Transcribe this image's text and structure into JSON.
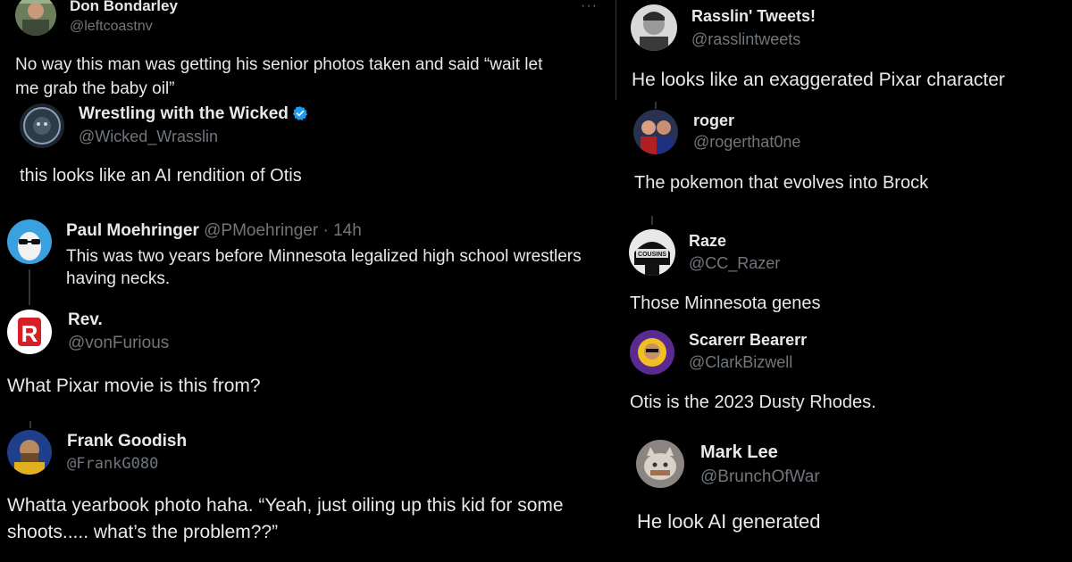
{
  "left": {
    "t1": {
      "name": "Don Bondarley",
      "handle": "@leftcoastnv",
      "text_l1": "No way this man was getting his senior photos taken and said “wait let",
      "text_l2": "me grab the baby oil”",
      "more": "···"
    },
    "t2": {
      "name": "Wrestling with the Wicked",
      "handle": "@Wicked_Wrasslin",
      "text": "this looks like an AI rendition of Otis"
    },
    "t3": {
      "name": "Paul Moehringer",
      "handle": "@PMoehringer",
      "time": "· 14h",
      "text_l1": "This was two years before Minnesota legalized high school wrestlers",
      "text_l2": "having necks."
    },
    "t4": {
      "name": "Rev.",
      "handle": "@vonFurious",
      "text": "What Pixar movie is this from?"
    },
    "t5": {
      "name": "Frank Goodish",
      "handle": "@FrankG080",
      "text_l1": "Whatta yearbook photo haha. “Yeah, just oiling up this kid for some",
      "text_l2": "shoots..... what’s the problem??”"
    }
  },
  "right": {
    "t1": {
      "name": "Rasslin' Tweets!",
      "handle": "@rasslintweets",
      "text": "He looks like an exaggerated Pixar character"
    },
    "t2": {
      "name": "roger",
      "handle": "@rogerthat0ne",
      "text": "The pokemon that evolves into Brock"
    },
    "t3": {
      "name": "Raze",
      "handle": "@CC_Razer",
      "text": "Those Minnesota genes",
      "avatar_text": "COUSINS"
    },
    "t4": {
      "name": "Scarerr Bearerr",
      "handle": "@ClarkBizwell",
      "text": "Otis is the 2023 Dusty Rhodes."
    },
    "t5": {
      "name": "Mark Lee",
      "handle": "@BrunchOfWar",
      "text": "He look AI generated"
    }
  },
  "icons": {
    "verified": "verified-badge-icon",
    "more": "more-options-icon"
  },
  "colors": {
    "background": "#000000",
    "text": "#e7e9ea",
    "secondary": "#71767b",
    "verified": "#1d9bf0"
  }
}
